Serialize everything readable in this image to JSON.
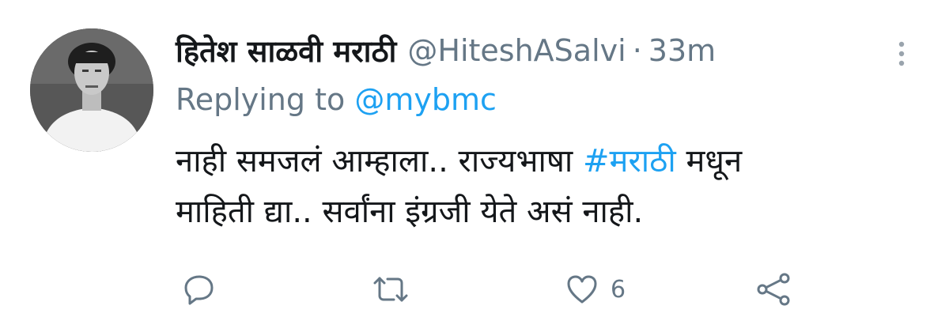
{
  "tweet": {
    "display_name": "हितेश साळवी मराठी",
    "handle": "@HiteshASalvi",
    "separator": "·",
    "time": "33m",
    "reply_prefix": "Replying to",
    "reply_mention": "@mybmc",
    "text_line1_a": "नाही समजलं आम्हाला.. राज्यभाषा",
    "text_hashtag": "#मराठी",
    "text_line1_b": "मधून",
    "text_line2": "माहिती द्या.. सर्वांना इंग्रजी येते असं नाही."
  },
  "actions": {
    "reply_icon": "reply-icon",
    "retweet_icon": "retweet-icon",
    "like_icon": "heart-icon",
    "like_count": "6",
    "share_icon": "share-icon"
  },
  "colors": {
    "accent": "#1da1f2",
    "text": "#14171a",
    "muted": "#657786"
  }
}
